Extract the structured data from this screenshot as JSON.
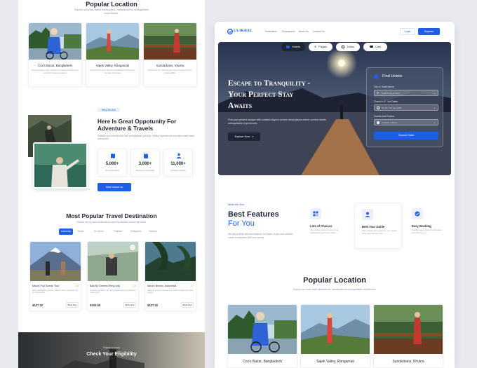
{
  "left": {
    "popular": {
      "title": "Popular Location",
      "subtitle": "Explore our most visited destinations, handpicked for unforgettable experiences.",
      "cards": [
        {
          "name": "Cox's Bazar, Bangladesh",
          "desc": "Explore endless sandy beaches and serene coastal views perfect for relaxing getaways."
        },
        {
          "name": "Sajek Valley, Rangamati",
          "desc": "Discover lush green hills and breathtaking clouds above the valley landscape."
        },
        {
          "name": "Sundarbans, Khulna",
          "desc": "Experience the world's largest mangrove forest and its unique wildlife."
        }
      ]
    },
    "why": {
      "tag": "Why Wa Are",
      "title_l1": "Here Is Great Oppotunity For",
      "title_l2": "Adventure & Travels",
      "desc": "Unleash your adventurous with unforgettable journeys, thrilling experiences and tailor-made travel adventures.",
      "stats": [
        {
          "value": "5,000+",
          "label": "Top Destination"
        },
        {
          "value": "3,000+",
          "label": "Booking Completed"
        },
        {
          "value": "11,000+",
          "label": "Satisfied Clients"
        }
      ],
      "button": "More About us"
    },
    "destinations": {
      "title": "Most Popular Travel Destination",
      "subtitle": "Explore the top travel destinations loved by travelers around the world.",
      "tabs": [
        "Indonesia",
        "Nepal",
        "Sri Lanka",
        "Thailand",
        "Philippines",
        "Vietnam"
      ],
      "cards": [
        {
          "name": "Mount Fuji Scenic Tour",
          "rating": "4.8",
          "desc": "Enjoy breathtaking views of Japan's iconic mountain and its surroundings.",
          "price": "$127.32",
          "cta": "Book Now"
        },
        {
          "name": "Bali By Greens Rring (ok)",
          "rating": "4.9",
          "desc": "Immerse yourself in lush green landscapes and peaceful nature trails.",
          "price": "$100.00",
          "cta": "Book Now"
        },
        {
          "name": "Mount Bromo, Indonesia",
          "rating": "4.7",
          "desc": "Witness stunning sunrises over volcanic peaks and misty valleys.",
          "price": "$127.32",
          "cta": "Book Now"
        }
      ]
    },
    "eligibility": {
      "small": "Eligible to travel",
      "title": "Check Your Eligibility"
    }
  },
  "right": {
    "nav": {
      "logo": "ULIKBAL",
      "links": [
        "Destination",
        "Experiences",
        "About Us",
        "Contact Us"
      ],
      "login": "Login",
      "register": "Register"
    },
    "tabs": [
      "Hotels",
      "Flights",
      "Trains",
      "Cars"
    ],
    "hero": {
      "title_l1": "Escape to Tranquility -",
      "title_l2": "Your Perfect Stay",
      "title_l3": "Awaits",
      "desc": "Find your perfect escape with curated stays in serene destinations where comfort meets unforgettable experiences.",
      "cta": "Explore Now"
    },
    "find": {
      "title": "Find Hotels",
      "city_label": "City or Hotel Name",
      "city_placeholder": "Search city or hotel",
      "dates_label": "Check In & - out Dates",
      "dates_value": "04 Jan - 08 Jan 2026",
      "guests_label": "Guests and Rooms",
      "guests_value": "2 Adults, 1 Room",
      "button": "Search Hotel"
    },
    "features": {
      "tag": "What We Give",
      "title_l1": "Best Features",
      "title_l2": "For You",
      "desc": "We will provide the best features for those of you who want to travel comfortably with your family.",
      "items": [
        {
          "title": "Lots of Choices",
          "desc": "Find unique places to stay in top destinations across the globe."
        },
        {
          "title": "Best Tour Guide",
          "desc": "Enjoy hassle-free exploring - our guides bring destinations to life."
        },
        {
          "title": "Easy Booking",
          "desc": "Flexible dates, instant confirmation, and 24/7 support."
        }
      ]
    },
    "popular": {
      "title": "Popular Location",
      "subtitle": "Explore our most loved destinations, handpicked for unforgettable experiences.",
      "cards": [
        {
          "name": "Cox's Bazar, Bangladesh"
        },
        {
          "name": "Sajek Valley, Rangamati"
        },
        {
          "name": "Sundarbans, Khulna"
        }
      ]
    }
  },
  "colors": {
    "accent": "#1f5fe6",
    "dark": "#1d2433",
    "muted": "#8a90a0"
  }
}
